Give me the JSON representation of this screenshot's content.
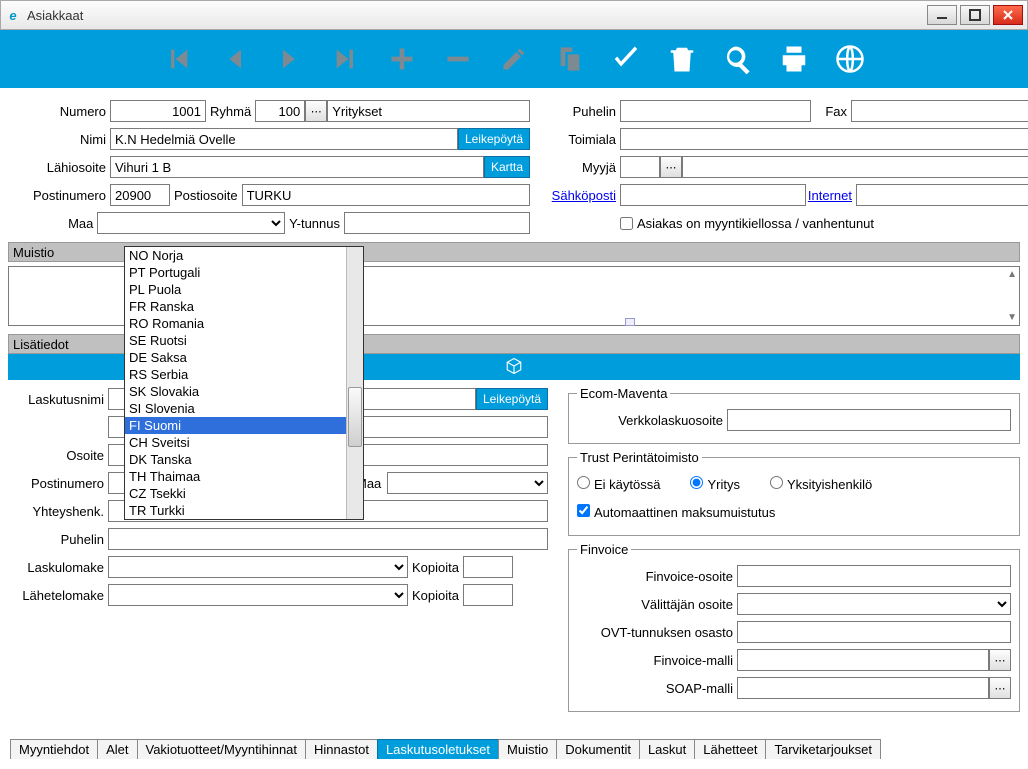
{
  "window": {
    "title": "Asiakkaat"
  },
  "form": {
    "numero_label": "Numero",
    "numero_value": "1001",
    "ryhma_label": "Ryhmä",
    "ryhma_value": "100",
    "ryhma_name": "Yritykset",
    "nimi_label": "Nimi",
    "nimi_value": "K.N Hedelmiä Ovelle",
    "leikepoyta_btn": "Leikepöytä",
    "lahiosoite_label": "Lähiosoite",
    "lahiosoite_value": "Vihuri 1 B",
    "kartta_btn": "Kartta",
    "postinumero_label": "Postinumero",
    "postinumero_value": "20900",
    "postiosoite_label": "Postiosoite",
    "postiosoite_value": "TURKU",
    "maa_label": "Maa",
    "ytunnus_label": "Y-tunnus",
    "ytunnus_value": "",
    "puhelin_label": "Puhelin",
    "puhelin_value": "",
    "fax_label": "Fax",
    "fax_value": "",
    "toimiala_label": "Toimiala",
    "toimiala_value": "",
    "myyja_label": "Myyjä",
    "myyja_value": "",
    "sahkoposti_link": "Sähköposti",
    "sahkoposti_value": "",
    "internet_link": "Internet",
    "internet_value": "",
    "kielto_label": "Asiakas on myyntikiellossa / vanhentunut"
  },
  "maa_dropdown": {
    "items": [
      "NO Norja",
      "PT Portugali",
      "PL Puola",
      "FR Ranska",
      "RO Romania",
      "SE Ruotsi",
      "DE Saksa",
      "RS Serbia",
      "SK Slovakia",
      "SI Slovenia",
      "FI Suomi",
      "CH Sveitsi",
      "DK Tanska",
      "TH Thaimaa",
      "CZ Tsekki",
      "TR Turkki"
    ],
    "selected_index": 10
  },
  "sections": {
    "muistio": "Muistio",
    "lisatiedot": "Lisätiedot"
  },
  "billing": {
    "laskutusnimi_label": "Laskutusnimi",
    "leikepoyta_btn": "Leikepöytä",
    "osoite_label": "Osoite",
    "postinumero_label": "Postinumero",
    "maa_label": "Maa",
    "yhteyshenk_label": "Yhteyshenk.",
    "puhelin_label": "Puhelin",
    "laskulomake_label": "Laskulomake",
    "kopioita_label": "Kopioita",
    "lahetelomake_label": "Lähetelomake"
  },
  "ecom": {
    "group_title": "Ecom-Maventa",
    "verkkolaskuosoite_label": "Verkkolaskuosoite"
  },
  "trust": {
    "group_title": "Trust Perintätoimisto",
    "ei_kaytossa": "Ei käytössä",
    "yritys": "Yritys",
    "yksityis": "Yksityishenkilö",
    "automaattinen": "Automaattinen maksumuistutus"
  },
  "finvoice": {
    "group_title": "Finvoice",
    "osoite": "Finvoice-osoite",
    "valittaja": "Välittäjän osoite",
    "ovt": "OVT-tunnuksen osasto",
    "malli": "Finvoice-malli",
    "soap": "SOAP-malli"
  },
  "tabs": [
    "Myyntiehdot",
    "Alet",
    "Vakiotuotteet/Myyntihinnat",
    "Hinnastot",
    "Laskutusoletukset",
    "Muistio",
    "Dokumentit",
    "Laskut",
    "Lähetteet",
    "Tarviketarjoukset"
  ],
  "active_tab_index": 4
}
